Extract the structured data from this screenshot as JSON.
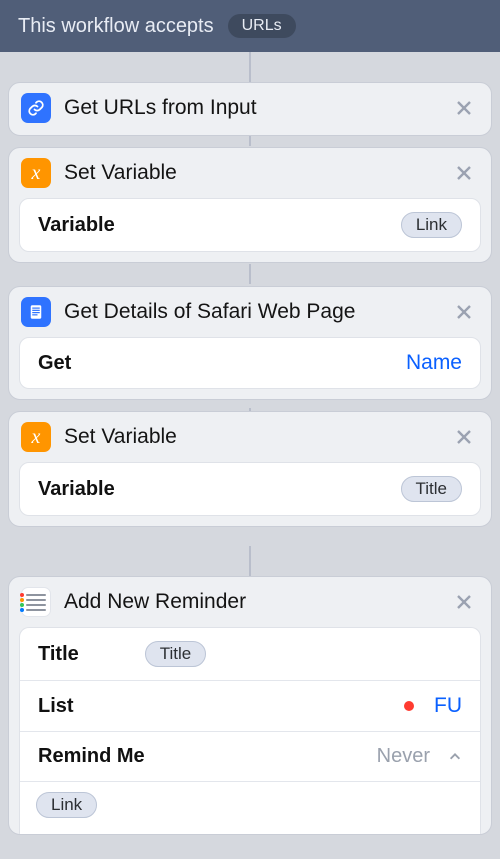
{
  "header": {
    "prefix": "This workflow accepts",
    "input_type": "URLs"
  },
  "actions": [
    {
      "id": "get-urls",
      "title": "Get URLs from Input",
      "icon": "link-icon",
      "icon_bg": "blue",
      "rows": []
    },
    {
      "id": "set-var-link",
      "title": "Set Variable",
      "icon": "variable-icon",
      "icon_bg": "orange",
      "rows": [
        {
          "label": "Variable",
          "value_token": "Link",
          "kind": "token-right"
        }
      ]
    },
    {
      "id": "get-safari-details",
      "title": "Get Details of Safari Web Page",
      "icon": "document-icon",
      "icon_bg": "blue",
      "rows": [
        {
          "label": "Get",
          "value_link": "Name",
          "kind": "link-right"
        }
      ]
    },
    {
      "id": "set-var-title",
      "title": "Set Variable",
      "icon": "variable-icon",
      "icon_bg": "orange",
      "rows": [
        {
          "label": "Variable",
          "value_token": "Title",
          "kind": "token-right"
        }
      ]
    },
    {
      "id": "add-reminder",
      "title": "Add New Reminder",
      "icon": "reminders-icon",
      "icon_bg": "white",
      "rows": [
        {
          "label": "Title",
          "value_token": "Title",
          "kind": "token-inline"
        },
        {
          "label": "List",
          "value_link": "FU",
          "kind": "list-right",
          "dot_color": "#ff3b30"
        },
        {
          "label": "Remind Me",
          "value_muted": "Never",
          "kind": "muted-chevron"
        }
      ],
      "note_token": "Link"
    }
  ]
}
